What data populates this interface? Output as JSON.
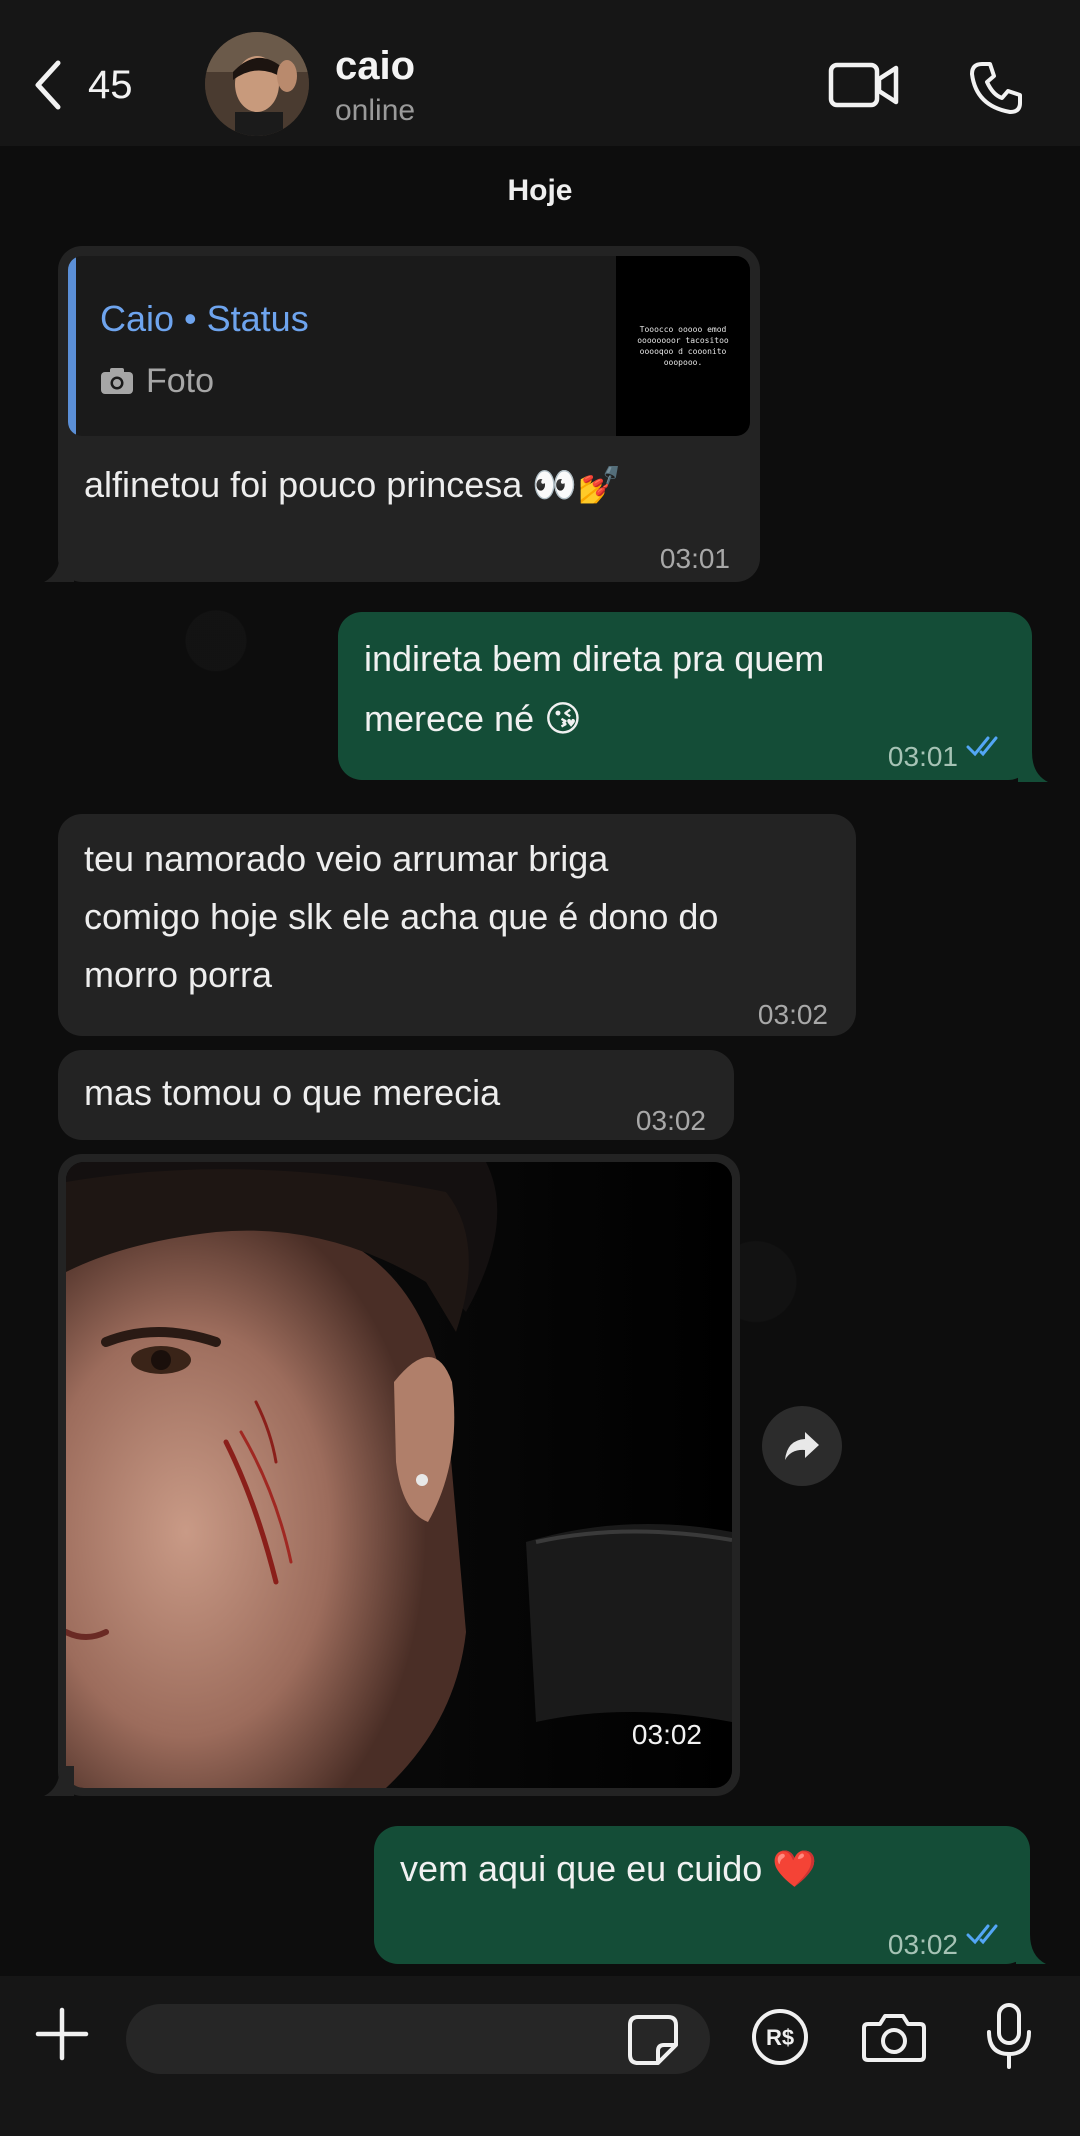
{
  "header": {
    "back_count": "45",
    "contact_name": "caio",
    "contact_status": "online"
  },
  "date_separator": "Hoje",
  "messages": [
    {
      "direction": "in",
      "quote_author": "Caio • Status",
      "quote_kind": "Foto",
      "quote_thumb_text": "Tooocco ooooo emod oooooooor tacositoo ooooqoo d cooonito ooopooo.",
      "text": "alfinetou foi pouco princesa 👀💅",
      "time": "03:01"
    },
    {
      "direction": "out",
      "text_line1": "indireta bem direta pra quem",
      "text_line2": "merece né 😘",
      "time": "03:01"
    },
    {
      "direction": "in",
      "text_line1": "teu namorado veio arrumar briga",
      "text_line2": "comigo hoje slk ele acha que é dono do",
      "text_line3": "morro porra",
      "time": "03:02"
    },
    {
      "direction": "in",
      "text": "mas tomou o que merecia",
      "time": "03:02"
    },
    {
      "direction": "in",
      "type": "photo",
      "time": "03:02"
    },
    {
      "direction": "out",
      "text": "vem aqui que eu cuido ❤️",
      "time": "03:02"
    }
  ],
  "colors": {
    "incoming_bubble": "#232323",
    "outgoing_bubble": "#144d37",
    "quote_accent": "#5b8fd6",
    "read_ticks": "#53a6f5"
  },
  "icons": [
    "chevron-left-icon",
    "video-call-icon",
    "phone-icon",
    "camera-icon",
    "forward-icon",
    "plus-icon",
    "sticker-icon",
    "payment-icon",
    "microphone-icon"
  ]
}
